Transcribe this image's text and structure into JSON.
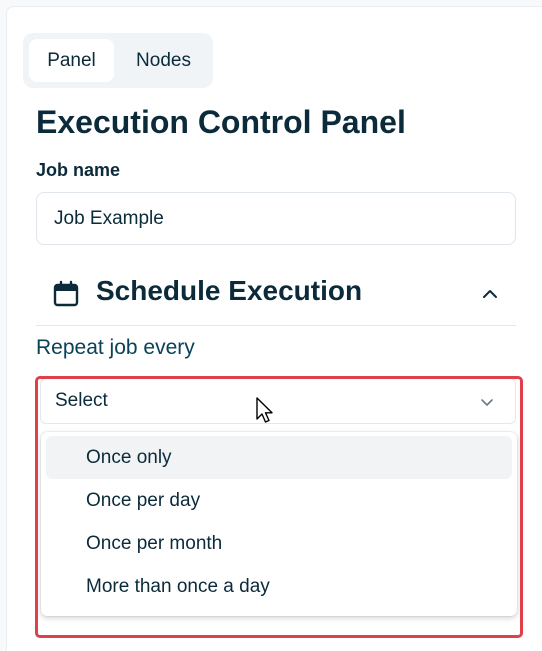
{
  "tabs": [
    {
      "label": "Panel",
      "active": true
    },
    {
      "label": "Nodes",
      "active": false
    }
  ],
  "title": "Execution Control Panel",
  "job": {
    "label": "Job name",
    "value": "Job Example"
  },
  "schedule": {
    "title": "Schedule Execution",
    "icon": "calendar-icon",
    "expanded": true
  },
  "repeat": {
    "label": "Repeat job every",
    "select_value": "Select",
    "options": [
      "Once only",
      "Once per day",
      "Once per month",
      "More than once a day"
    ],
    "hovered_option": "Once only"
  },
  "colors": {
    "text": "#0b2a3a",
    "highlight": "#e0404a",
    "tab_bg": "#f1f4f7"
  }
}
